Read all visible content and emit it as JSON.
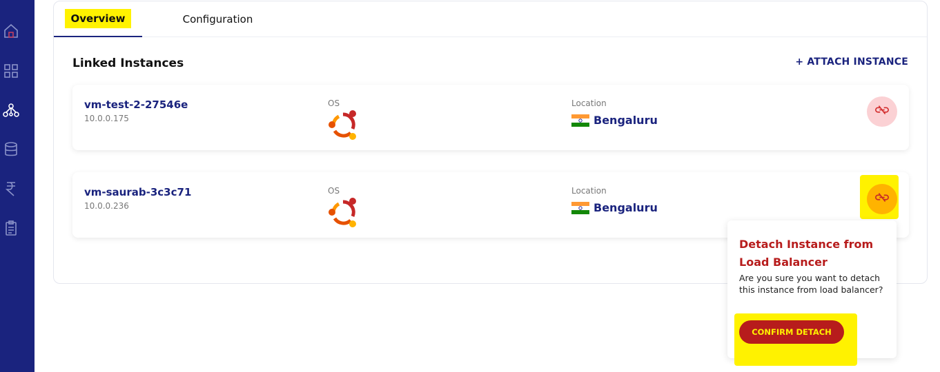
{
  "sidebar": {
    "items": [
      {
        "icon": "home-icon"
      },
      {
        "icon": "grid-icon"
      },
      {
        "icon": "network-icon"
      },
      {
        "icon": "database-icon"
      },
      {
        "icon": "rupee-icon"
      },
      {
        "icon": "clipboard-icon"
      }
    ],
    "accent": "#1a237e"
  },
  "tabs": [
    {
      "label": "Overview"
    },
    {
      "label": "Configuration"
    }
  ],
  "section": {
    "title": "Linked Instances",
    "attach_label": "+ ATTACH INSTANCE"
  },
  "instances": [
    {
      "name": "vm-test-2-27546e",
      "ip": "10.0.0.175",
      "os_label": "OS",
      "os_icon": "ubuntu-logo",
      "location_label": "Location",
      "location": "Bengaluru",
      "flag": "india-flag"
    },
    {
      "name": "vm-saurab-3c3c71",
      "ip": "10.0.0.236",
      "os_label": "OS",
      "os_icon": "ubuntu-logo",
      "location_label": "Location",
      "location": "Bengaluru",
      "flag": "india-flag"
    }
  ],
  "popover": {
    "title": "Detach Instance from Load Balancer",
    "message": "Are you sure you want to detach this instance from load balancer?",
    "confirm_label": "CONFIRM DETACH"
  },
  "colors": {
    "primary": "#1a237e",
    "danger": "#b71c1c",
    "highlight": "#fff200",
    "detach_idle": "#fbd1d4",
    "detach_active": "#ffb300"
  }
}
